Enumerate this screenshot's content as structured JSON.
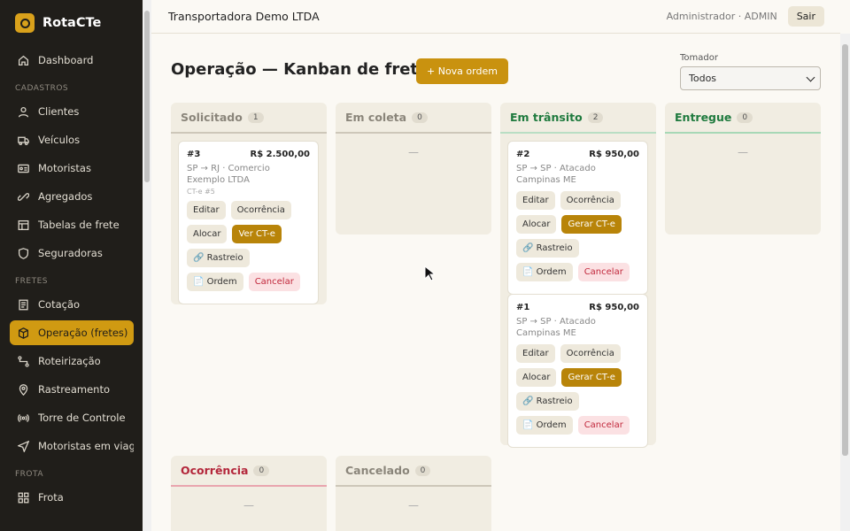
{
  "app": {
    "name": "RotaCTe"
  },
  "sidebar": {
    "top_item": {
      "label": "Dashboard",
      "icon": "home-icon"
    },
    "sections": [
      {
        "title": "CADASTROS",
        "items": [
          {
            "label": "Clientes",
            "icon": "user-icon"
          },
          {
            "label": "Veículos",
            "icon": "truck-icon"
          },
          {
            "label": "Motoristas",
            "icon": "id-card-icon"
          },
          {
            "label": "Agregados",
            "icon": "link-icon"
          },
          {
            "label": "Tabelas de frete",
            "icon": "table-icon"
          },
          {
            "label": "Seguradoras",
            "icon": "shield-icon"
          }
        ]
      },
      {
        "title": "FRETES",
        "items": [
          {
            "label": "Cotação",
            "icon": "document-icon"
          },
          {
            "label": "Operação (fretes)",
            "icon": "box-icon",
            "active": true
          },
          {
            "label": "Roteirização",
            "icon": "route-icon"
          },
          {
            "label": "Rastreamento",
            "icon": "pin-icon"
          },
          {
            "label": "Torre de Controle",
            "icon": "broadcast-icon"
          },
          {
            "label": "Motoristas em viag…",
            "icon": "send-icon"
          }
        ]
      },
      {
        "title": "FROTA",
        "items": [
          {
            "label": "Frota",
            "icon": "grid-icon"
          }
        ]
      }
    ]
  },
  "header": {
    "company": "Transportadora Demo LTDA",
    "user": "Administrador · ADMIN",
    "logout": "Sair"
  },
  "page": {
    "title": "Operação — Kanban de fretes",
    "new_button": "+ Nova ordem",
    "filter": {
      "label": "Tomador",
      "value": "Todos"
    }
  },
  "empty_marker": "—",
  "columns": [
    {
      "title": "Solicitado",
      "count": "1"
    },
    {
      "title": "Em coleta",
      "count": "0"
    },
    {
      "title": "Em trânsito",
      "count": "2"
    },
    {
      "title": "Entregue",
      "count": "0"
    },
    {
      "title": "Ocorrência",
      "count": "0"
    },
    {
      "title": "Cancelado",
      "count": "0"
    }
  ],
  "cards": [
    {
      "id": "#3",
      "value": "R$ 2.500,00",
      "route": "SP → RJ · Comercio Exemplo LTDA",
      "meta": "CT-e #5",
      "buttons": {
        "edit": "Editar",
        "occurrence": "Ocorrência",
        "allocate": "Alocar",
        "cte": "Ver CT-e",
        "tracking": "🔗 Rastreio",
        "order": "📄 Ordem",
        "cancel": "Cancelar"
      }
    },
    {
      "id": "#2",
      "value": "R$ 950,00",
      "route": "SP → SP · Atacado Campinas ME",
      "buttons": {
        "edit": "Editar",
        "occurrence": "Ocorrência",
        "allocate": "Alocar",
        "cte": "Gerar CT-e",
        "tracking": "🔗 Rastreio",
        "order": "📄 Ordem",
        "cancel": "Cancelar"
      }
    },
    {
      "id": "#1",
      "value": "R$ 950,00",
      "route": "SP → SP · Atacado Campinas ME",
      "buttons": {
        "edit": "Editar",
        "occurrence": "Ocorrência",
        "allocate": "Alocar",
        "cte": "Gerar CT-e",
        "tracking": "🔗 Rastreio",
        "order": "📄 Ordem",
        "cancel": "Cancelar"
      }
    }
  ]
}
